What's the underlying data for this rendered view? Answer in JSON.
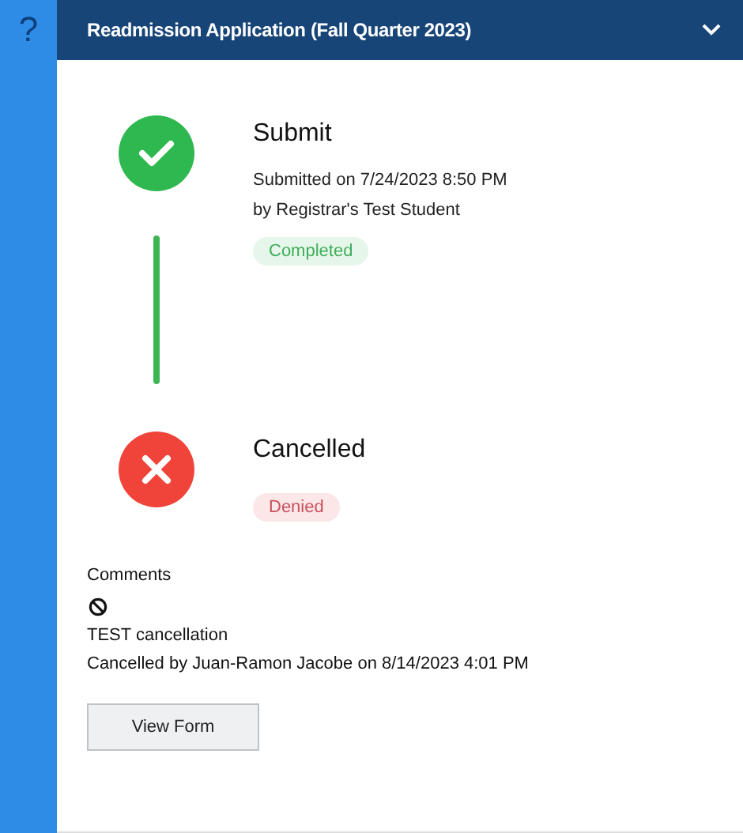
{
  "help": {
    "label": "?"
  },
  "header": {
    "title": "Readmission Application (Fall Quarter 2023)",
    "expanded": true
  },
  "steps": [
    {
      "kind": "completed",
      "title": "Submit",
      "details": [
        "Submitted on 7/24/2023 8:50 PM",
        "by Registrar's Test Student"
      ],
      "status": "Completed"
    },
    {
      "kind": "cancelled",
      "title": "Cancelled",
      "status": "Denied"
    }
  ],
  "comments": {
    "heading": "Comments",
    "text": "TEST cancellation",
    "byline": "Cancelled by Juan-Ramon Jacobe on 8/14/2023 4:01 PM"
  },
  "buttons": [
    "View Form"
  ]
}
